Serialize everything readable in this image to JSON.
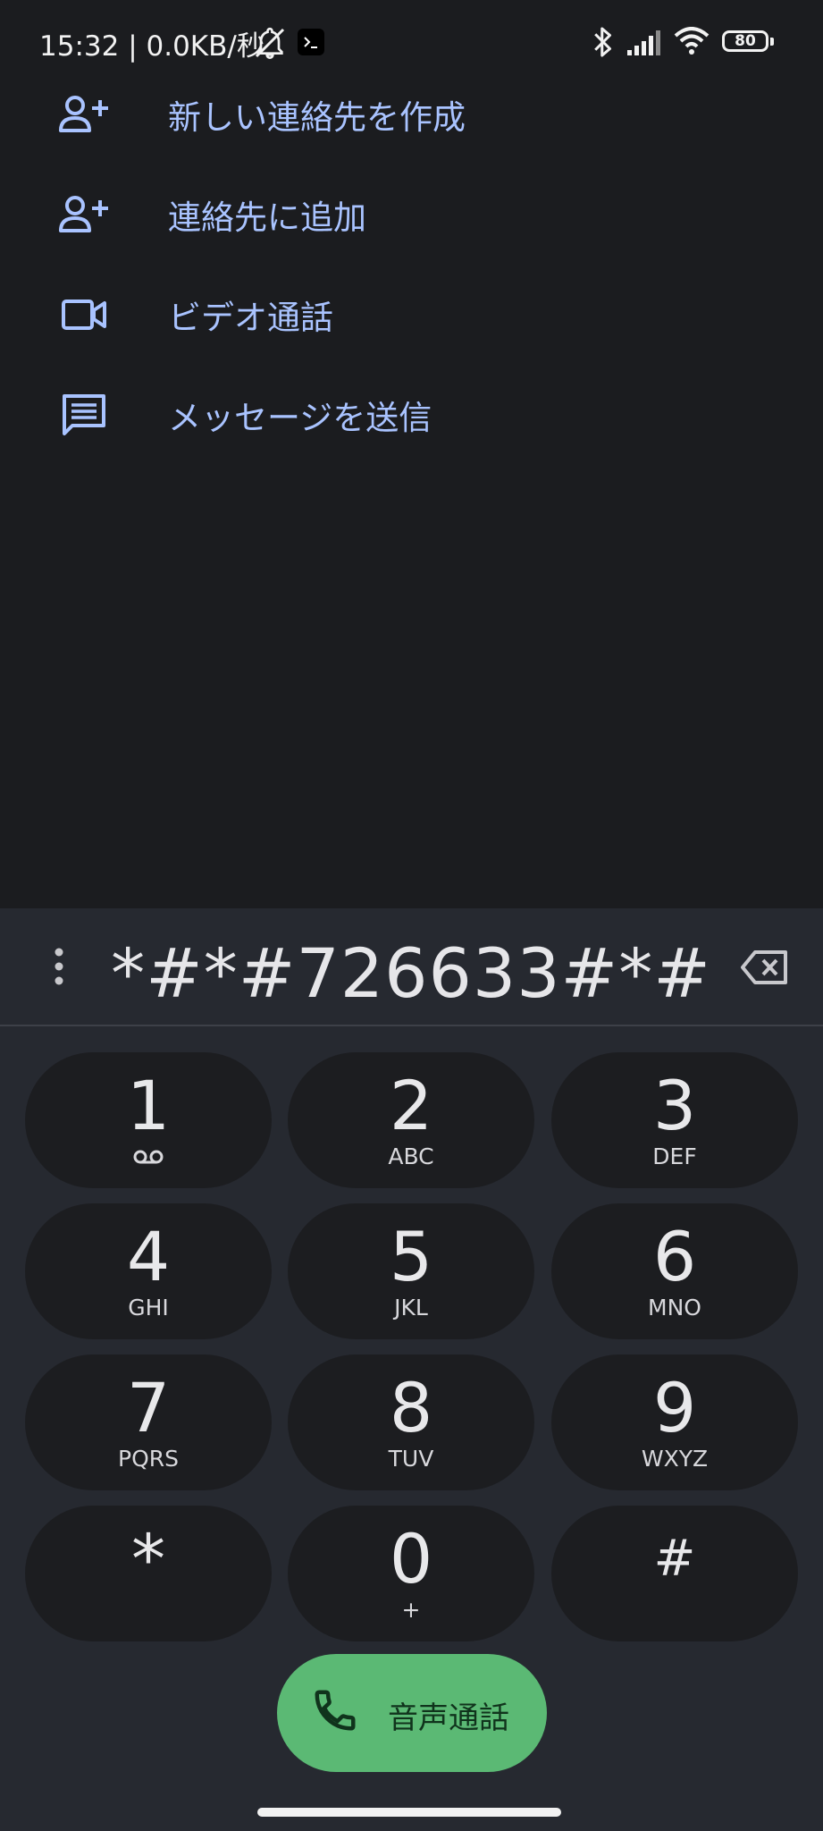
{
  "status_bar": {
    "text": "15:32 | 0.0KB/秒",
    "battery_level": "80",
    "icons": [
      "dnd-bell-off-icon",
      "terminal-icon",
      "bluetooth-icon",
      "cellular-signal-icon",
      "wifi-icon",
      "battery-icon"
    ]
  },
  "actions": [
    {
      "label": "新しい連絡先を作成",
      "icon": "person-add-icon"
    },
    {
      "label": "連絡先に追加",
      "icon": "person-add-icon"
    },
    {
      "label": "ビデオ通話",
      "icon": "video-camera-icon"
    },
    {
      "label": "メッセージを送信",
      "icon": "message-icon"
    }
  ],
  "dialpad": {
    "number": "*#*#726633#*#",
    "keys": [
      {
        "digit": "1",
        "sub": ""
      },
      {
        "digit": "2",
        "sub": "ABC"
      },
      {
        "digit": "3",
        "sub": "DEF"
      },
      {
        "digit": "4",
        "sub": "GHI"
      },
      {
        "digit": "5",
        "sub": "JKL"
      },
      {
        "digit": "6",
        "sub": "MNO"
      },
      {
        "digit": "7",
        "sub": "PQRS"
      },
      {
        "digit": "8",
        "sub": "TUV"
      },
      {
        "digit": "9",
        "sub": "WXYZ"
      },
      {
        "digit": "*",
        "sub": ""
      },
      {
        "digit": "0",
        "sub": "+"
      },
      {
        "digit": "#",
        "sub": ""
      }
    ],
    "call_label": "音声通話"
  },
  "colors": {
    "background": "#1b1c1f",
    "accent_text": "#a9c3ff",
    "dialpad_panel": "#262930",
    "key_background": "#1c1d20",
    "call_button": "#5bb974"
  }
}
